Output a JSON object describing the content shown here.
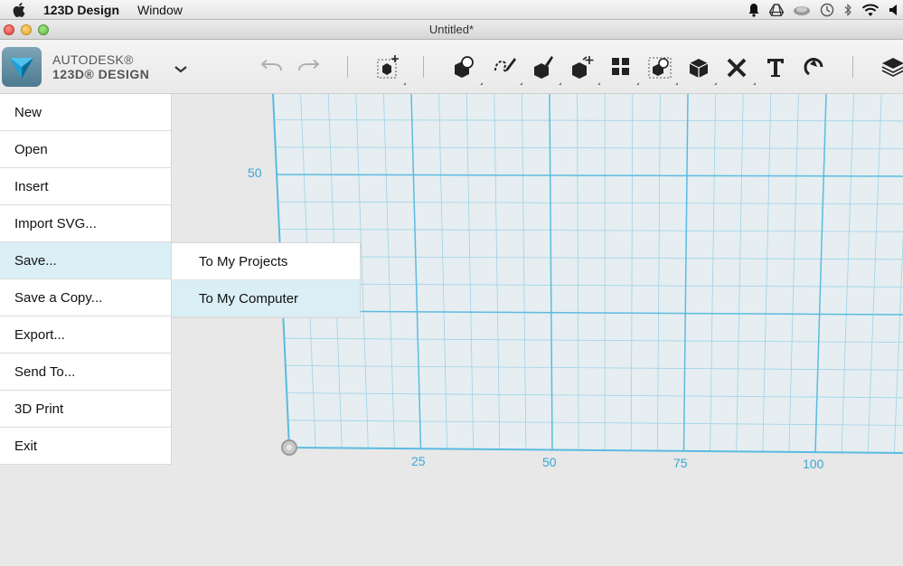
{
  "menubar": {
    "app_name": "123D Design",
    "menus": [
      "Window"
    ],
    "status_icons": [
      "notification-bell-icon",
      "google-drive-icon",
      "cloud-sync-icon",
      "time-machine-icon",
      "bluetooth-icon",
      "wifi-icon",
      "volume-icon"
    ]
  },
  "window": {
    "title": "Untitled*"
  },
  "brand": {
    "line1": "AUTODESK®",
    "line2": "123D® DESIGN"
  },
  "toolbar": {
    "tools": [
      "undo",
      "redo",
      "transform",
      "primitives",
      "sketch",
      "construct",
      "modify",
      "pattern",
      "grouping",
      "combine",
      "measure",
      "text",
      "snap",
      "material"
    ]
  },
  "file_menu": {
    "items": [
      "New",
      "Open",
      "Insert",
      "Import SVG...",
      "Save...",
      "Save a Copy...",
      "Export...",
      "Send To...",
      "3D Print",
      "Exit"
    ],
    "active_index": 4
  },
  "save_submenu": {
    "items": [
      "To My Projects",
      "To My Computer"
    ],
    "active_index": 1
  },
  "grid": {
    "axis_labels": [
      "50",
      "25",
      "50",
      "75",
      "100"
    ],
    "color": "#5bbbe0"
  }
}
